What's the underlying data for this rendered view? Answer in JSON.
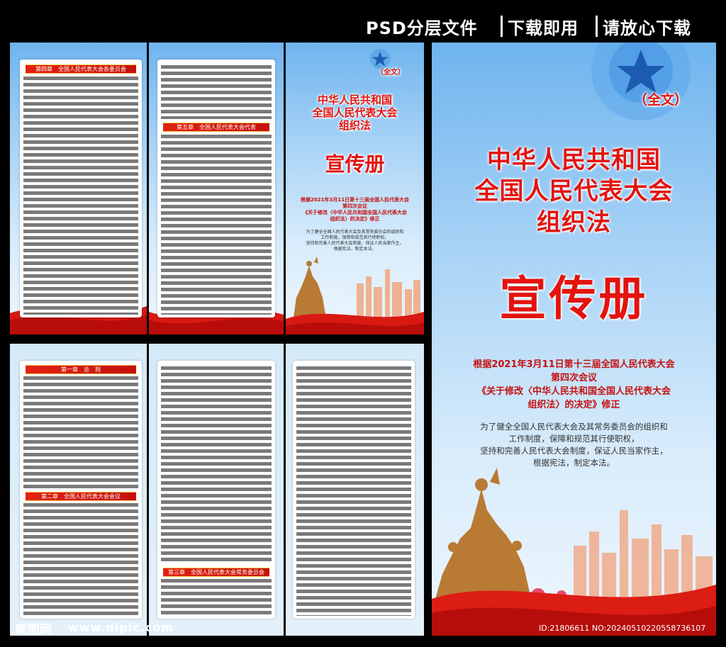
{
  "top_banner": {
    "part1": "PSD分层文件",
    "part2": "下载即用",
    "part3": "请放心下载"
  },
  "cover": {
    "full_text_tag": "（全文）",
    "title_line1": "中华人民共和国",
    "title_line2": "全国人民代表大会",
    "title_line3": "组织法",
    "subtitle": "宣传册",
    "basis_line1": "根据2021年3月11日第十三届全国人民代表大会",
    "basis_line2": "第四次会议",
    "basis_line3": "《关于修改〈中华人民共和国全国人民代表大会",
    "basis_line4": "组织法〉的决定》修正",
    "purpose_line1": "为了健全全国人民代表大会及其常务委员会的组织和",
    "purpose_line2": "工作制度，保障和规范其行使职权，",
    "purpose_line3": "坚持和完善人民代表大会制度，保证人民当家作主，",
    "purpose_line4": "根据宪法，制定本法。"
  },
  "chapters": {
    "ch1": "第一章　总　则",
    "ch2": "第二章　全国人民代表大会会议",
    "ch3": "第三章　全国人民代表大会常务委员会",
    "ch4": "第四章　全国人民代表大会各委员会",
    "ch5": "第五章　全国人民代表大会代表"
  },
  "watermark": {
    "site_logo": "昵图网",
    "site_url": "www.nipic.com",
    "image_id": "ID:21806611 NO:20240510220558736107"
  },
  "colors": {
    "brand_red": "#e4130e",
    "sky_blue": "#6fb4ee",
    "chapter_gold": "#f6c23b"
  }
}
